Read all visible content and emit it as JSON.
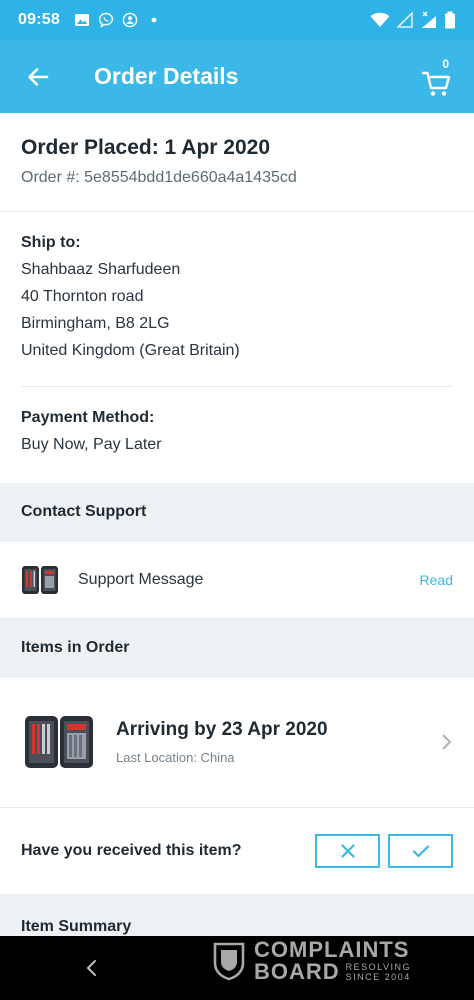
{
  "status_bar": {
    "time": "09:58"
  },
  "header": {
    "title": "Order Details",
    "cart_count": "0"
  },
  "order": {
    "placed": "Order Placed: 1 Apr 2020",
    "number": "Order #: 5e8554bdd1de660a4a1435cd"
  },
  "ship_to": {
    "label": "Ship to:",
    "name": "Shahbaaz Sharfudeen",
    "street": "40 Thornton road",
    "city": "Birmingham, B8 2LG",
    "country": "United Kingdom (Great Britain)"
  },
  "payment": {
    "label": "Payment Method:",
    "value": "Buy Now, Pay Later"
  },
  "contact_support": {
    "heading": "Contact Support",
    "message_label": "Support Message",
    "read_label": "Read"
  },
  "items": {
    "heading": "Items in Order",
    "arriving": "Arriving by 23 Apr 2020",
    "last_location": "Last Location: China"
  },
  "received": {
    "question": "Have you received this item?"
  },
  "summary": {
    "heading": "Item Summary"
  },
  "watermark": {
    "line1": "COMPLAINTS",
    "line2": "BOARD",
    "sub1": "RESOLVING",
    "sub2": "SINCE 2004"
  },
  "colors": {
    "accent": "#3bb8e8",
    "status_bar": "#2fb3e6",
    "section_bg": "#eef2f5"
  }
}
